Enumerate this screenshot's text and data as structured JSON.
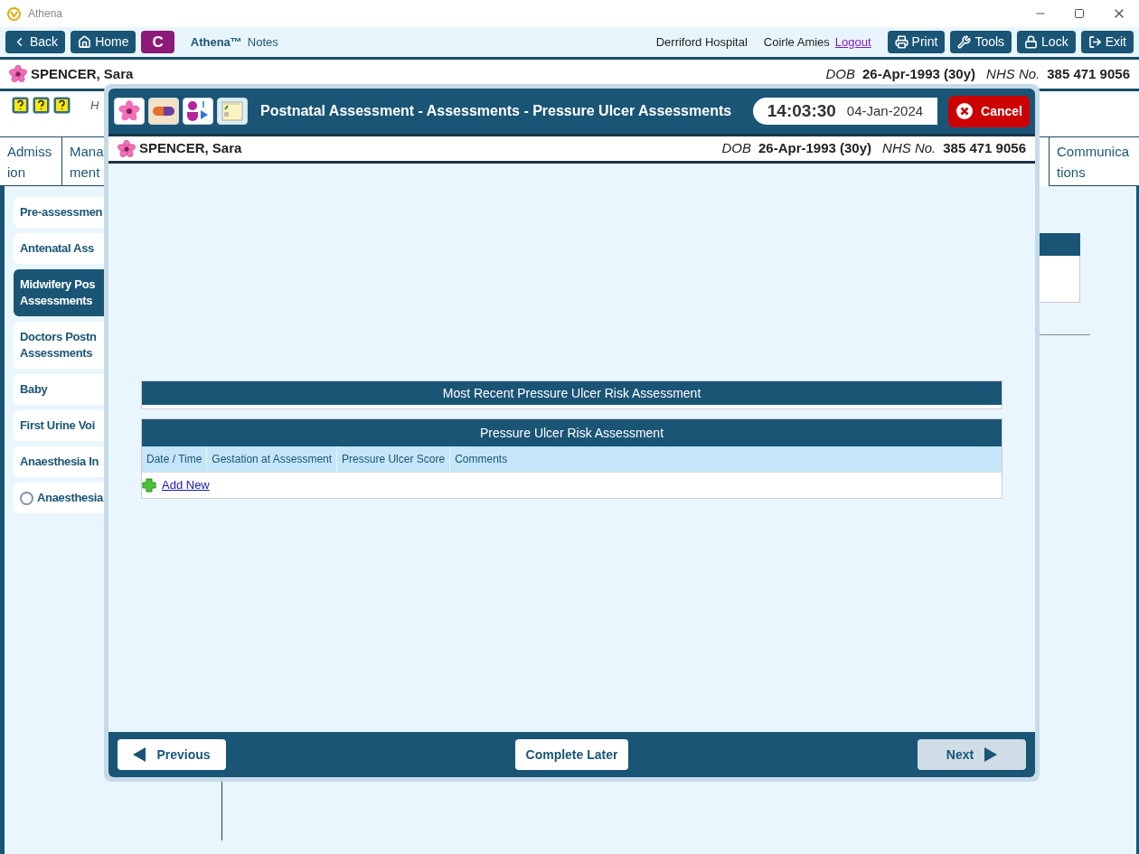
{
  "window": {
    "title": "Athena"
  },
  "toolbar": {
    "buttons": [
      {
        "label": "Back",
        "kind": "back"
      },
      {
        "label": "Home",
        "kind": "home"
      },
      {
        "label": "C",
        "kind": "badge"
      }
    ],
    "app_name": "Athena™",
    "app_suffix": "Notes",
    "hospital": "Derriford Hospital",
    "user": "Coirle Amies",
    "logout": "Logout",
    "actions": [
      {
        "label": "Print",
        "kind": "print"
      },
      {
        "label": "Tools",
        "kind": "tools"
      },
      {
        "label": "Lock",
        "kind": "lock"
      },
      {
        "label": "Exit",
        "kind": "exit"
      }
    ]
  },
  "patient": {
    "name": "SPENCER, Sara",
    "dob_label": "DOB",
    "dob": "26-Apr-1993 (30y)",
    "nhs_label": "NHS No.",
    "nhs": "385 471 9056"
  },
  "hint_text": "H",
  "tabs": [
    {
      "lines": [
        "Admiss",
        "ion"
      ]
    },
    {
      "lines": [
        "Mana",
        "ment"
      ]
    },
    {
      "lines": [
        "Communica",
        "tions"
      ]
    }
  ],
  "sidebar": [
    {
      "label": "Pre-assessmen",
      "kind": "plain",
      "selected": false
    },
    {
      "label": "Antenatal Ass",
      "kind": "plain",
      "selected": false
    },
    {
      "label": "Midwifery Pos\nAssessments",
      "kind": "plain",
      "selected": true
    },
    {
      "label": "Doctors Postn\nAssessments",
      "kind": "plain",
      "selected": false
    },
    {
      "label": "Baby",
      "kind": "plain",
      "selected": false
    },
    {
      "label": "First Urine Voi",
      "kind": "plain",
      "selected": false
    },
    {
      "label": "Anaesthesia In",
      "kind": "plain",
      "selected": false
    },
    {
      "label": "Anaesthesia",
      "kind": "radio",
      "selected": false
    }
  ],
  "dialog": {
    "title": "Postnatal Assessment - Assessments - Pressure Ulcer Assessments",
    "time": "14:03:30",
    "date": "04-Jan-2024",
    "cancel": "Cancel",
    "patient": {
      "name": "SPENCER, Sara",
      "dob_label": "DOB",
      "dob": "26-Apr-1993 (30y)",
      "nhs_label": "NHS No.",
      "nhs": "385 471 9056"
    },
    "recent": {
      "title": "Most Recent Pressure Ulcer Risk Assessment"
    },
    "table": {
      "title": "Pressure Ulcer Risk Assessment",
      "columns": [
        "Date / Time",
        "Gestation at Assessment",
        "Pressure Ulcer Score",
        "Comments"
      ],
      "add_new": "Add New"
    },
    "footer": {
      "previous": {
        "label": "Previous",
        "disabled": false
      },
      "complete_later": {
        "label": "Complete Later",
        "disabled": false
      },
      "next": {
        "label": "Next",
        "disabled": true
      }
    }
  }
}
